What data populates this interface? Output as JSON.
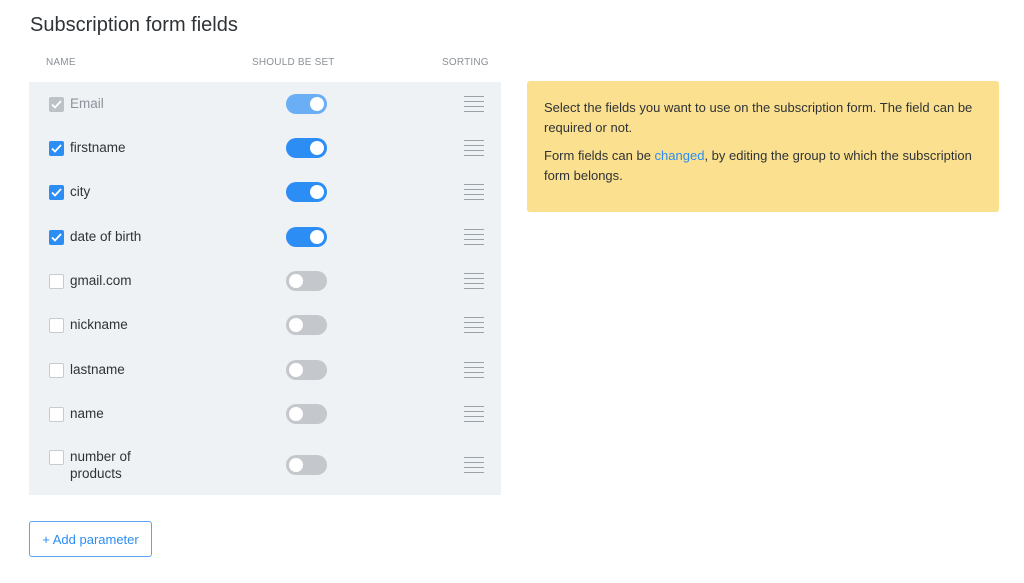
{
  "title": "Subscription form fields",
  "columns": {
    "name": "NAME",
    "should_be_set": "SHOULD BE SET",
    "sorting": "SORTING"
  },
  "fields": [
    {
      "label": "Email",
      "checked": true,
      "disabled": true,
      "required": true
    },
    {
      "label": "firstname",
      "checked": true,
      "disabled": false,
      "required": true
    },
    {
      "label": "city",
      "checked": true,
      "disabled": false,
      "required": true
    },
    {
      "label": "date of birth",
      "checked": true,
      "disabled": false,
      "required": true
    },
    {
      "label": "gmail.com",
      "checked": false,
      "disabled": false,
      "required": false
    },
    {
      "label": "nickname",
      "checked": false,
      "disabled": false,
      "required": false
    },
    {
      "label": "lastname",
      "checked": false,
      "disabled": false,
      "required": false
    },
    {
      "label": "name",
      "checked": false,
      "disabled": false,
      "required": false
    },
    {
      "label": "number of\nproducts",
      "checked": false,
      "disabled": false,
      "required": false
    }
  ],
  "info": {
    "paragraph1": "Select the fields you want to use on the subscription form. The field can be required or not.",
    "paragraph2_before": "Form fields can be ",
    "paragraph2_link": "changed",
    "paragraph2_after": ", by editing the group to which the subscription form belongs."
  },
  "add_button": "+ Add parameter",
  "colors": {
    "accent": "#2c8df4",
    "info_bg": "#fbe08f",
    "panel_bg": "#eff2f4"
  }
}
